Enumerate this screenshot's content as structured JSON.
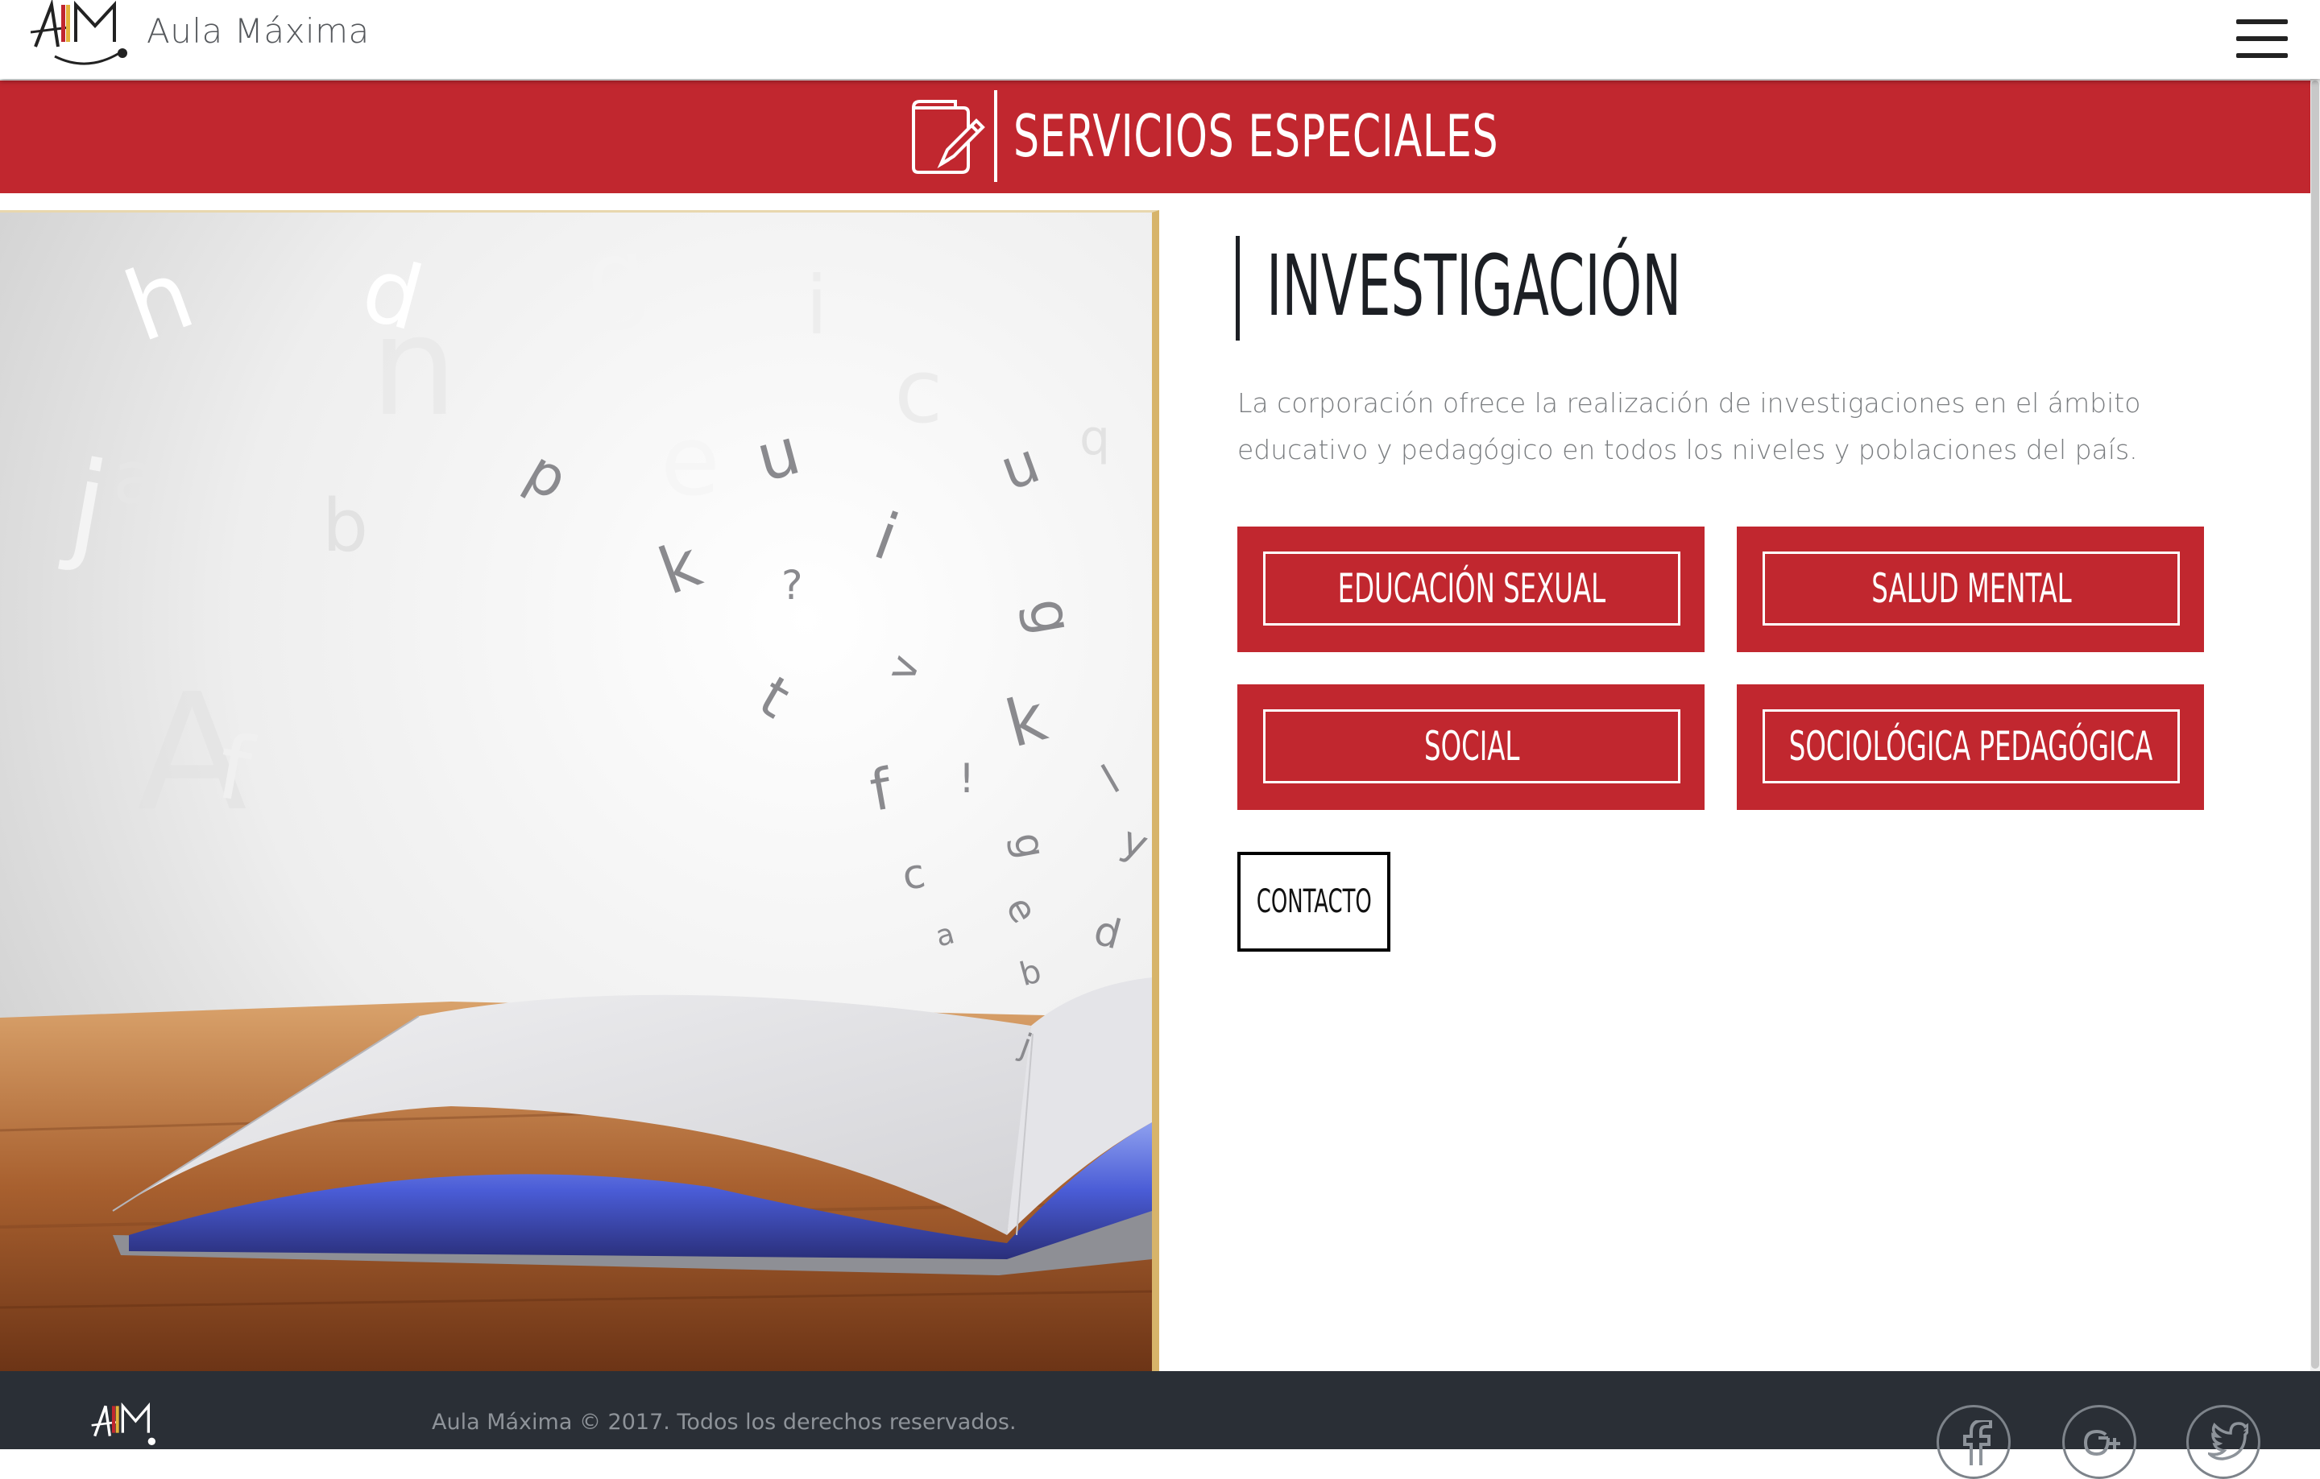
{
  "header": {
    "brand": "Aula Máxima",
    "logo_icon": "aula-maxima-logo",
    "menu_icon": "hamburger-menu-icon"
  },
  "banner": {
    "icon": "book-pencil-icon",
    "title": "SERVICIOS ESPECIALES",
    "color": "#c1272f"
  },
  "hero": {
    "image": "open-book-flying-letters",
    "letters": [
      "h",
      "d",
      "g",
      "i",
      "j",
      "b",
      "n",
      "e",
      "u",
      "p",
      "k",
      "?",
      "i",
      "u",
      "q",
      "c",
      "A",
      "f",
      "t",
      "v",
      "k",
      "f",
      "!",
      "g",
      "c",
      "e",
      "d",
      "a",
      "b",
      "j",
      "l",
      "y"
    ]
  },
  "main": {
    "section_title": "INVESTIGACIÓN",
    "description": "La corporación ofrece la realización de investigaciones en el ámbito educativo y pedagógico en todos los niveles y poblaciones del país.",
    "services": [
      {
        "label": "EDUCACIÓN SEXUAL"
      },
      {
        "label": "SALUD MENTAL"
      },
      {
        "label": "SOCIAL"
      },
      {
        "label": "SOCIOLÓGICA PEDAGÓGICA"
      }
    ],
    "contact_label": "CONTACTO"
  },
  "footer": {
    "copyright": "Aula Máxima © 2017. Todos los derechos reservados.",
    "social": [
      "facebook-icon",
      "google-plus-icon",
      "twitter-icon"
    ]
  },
  "colors": {
    "accent": "#c1272f",
    "footer_bg": "#2a2f36",
    "hero_border": "#d7b46a",
    "heading": "#1c1f24"
  }
}
